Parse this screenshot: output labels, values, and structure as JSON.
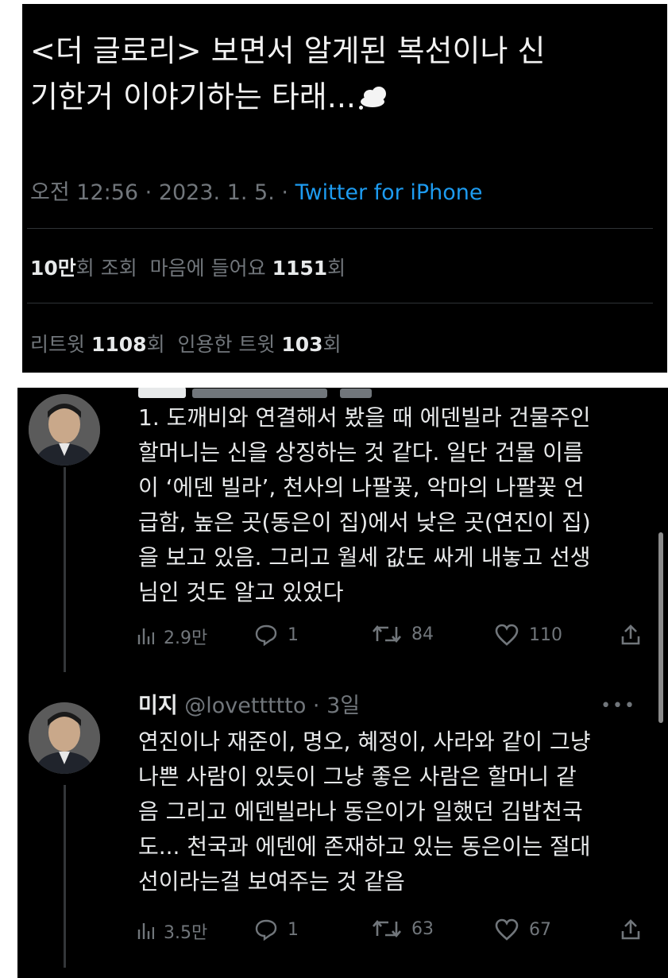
{
  "tweet": {
    "text_line1": "<더 글로리> 보면서 알게된 복선이나 신",
    "text_line2": "기한거 이야기하는 타래...",
    "time": "오전 12:56",
    "date": "2023. 1. 5.",
    "source": "Twitter for iPhone",
    "separator": " · ",
    "views_value": "10만",
    "views_label": "회 조회",
    "likes_label": "마음에 들어요",
    "likes_value": "1151",
    "likes_unit": "회",
    "retweets_label": "리트윗",
    "retweets_value": "1108",
    "retweets_unit": "회",
    "quotes_label": "인용한 트윗",
    "quotes_value": "103",
    "quotes_unit": "회"
  },
  "replies": [
    {
      "lines": [
        "1. 도깨비와 연결해서 봤을 때 에덴빌라 건물주인",
        "할머니는 신을 상징하는 것 같다. 일단 건물 이름",
        "이 ‘에덴 빌라’, 천사의 나팔꽃, 악마의 나팔꽃 언",
        "급함, 높은 곳(동은이 집)에서 낮은 곳(연진이 집)",
        "을 보고 있음. 그리고 월세 값도 싸게 내놓고 선생",
        "님인 것도 알고 있었다"
      ],
      "views": "2.9만",
      "comments": "1",
      "retweets": "84",
      "likes": "110"
    },
    {
      "name": "미지",
      "handle": "@lovettttto",
      "time": "3일",
      "lines": [
        "연진이나 재준이, 명오, 혜정이, 사라와 같이 그냥",
        "나쁜 사람이 있듯이 그냥 좋은 사람은 할머니 같",
        "음 그리고 에덴빌라나 동은이가 일했던 김밥천국",
        "도... 천국과 에덴에 존재하고 있는 동은이는 절대",
        "선이라는걸 보여주는 것 같음"
      ],
      "views": "3.5만",
      "comments": "1",
      "retweets": "63",
      "likes": "67"
    }
  ],
  "icons": {
    "thought": "thought-balloon-icon",
    "views": "bar-chart-icon",
    "reply": "speech-bubble-icon",
    "retweet": "retweet-icon",
    "like": "heart-icon",
    "share": "share-icon",
    "more": "more-icon"
  },
  "colors": {
    "background": "#000000",
    "text": "#e7e9ea",
    "muted": "#71767b",
    "link": "#1d9bf0"
  }
}
